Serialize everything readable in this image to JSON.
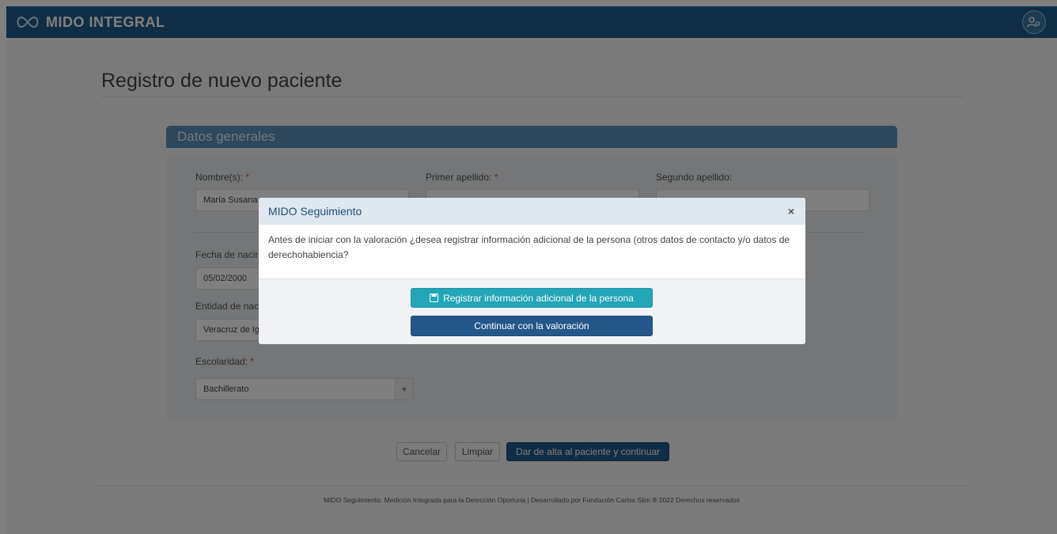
{
  "brand": {
    "name": "MIDO INTEGRAL"
  },
  "page": {
    "title": "Registro de nuevo paciente"
  },
  "section": {
    "title": "Datos generales"
  },
  "form": {
    "nombre": {
      "label": "Nombre(s):",
      "required_mark": "*",
      "value": "María Susana"
    },
    "primer_apellido": {
      "label": "Primer apellido:",
      "required_mark": "*"
    },
    "segundo_apellido": {
      "label": "Segundo apellido:"
    },
    "fecha_nacimiento": {
      "label_visible": "Fecha de nacir",
      "value": "05/02/2000"
    },
    "entidad_nacimiento": {
      "label_visible": "Entidad de nac",
      "value_visible": "Veracruz de Ig"
    },
    "escolaridad": {
      "label": "Escolaridad:",
      "required_mark": "*",
      "value": "Bachillerato"
    }
  },
  "actions": {
    "cancel": "Cancelar",
    "clear": "Limpiar",
    "submit": "Dar de alta al paciente y continuar"
  },
  "footer": {
    "text": "MIDO Seguimiento. Medición Integrada para la Detección Oportuna | Desarrollado por Fundación Carlos Slim ® 2022 Derechos reservados"
  },
  "modal": {
    "title": "MIDO Seguimiento",
    "close": "×",
    "message": "Antes de iniciar con la valoración ¿desea registrar información adicional de la persona (otros datos de contacto y/o datos de derechohabiencia?",
    "register_button": "Registrar información adicional de la persona",
    "continue_button": "Continuar con la valoración"
  },
  "colors": {
    "navbar": "#1e5d8c",
    "section_header": "#5b8fbb",
    "primary": "#1f5a8a",
    "info": "#22a6b8",
    "required": "#d9534f"
  },
  "icons": {
    "brand": "infinity-logo-icon",
    "user": "user-settings-icon",
    "save": "floppy-disk-icon",
    "close": "close-icon",
    "caret": "caret-down-icon"
  }
}
